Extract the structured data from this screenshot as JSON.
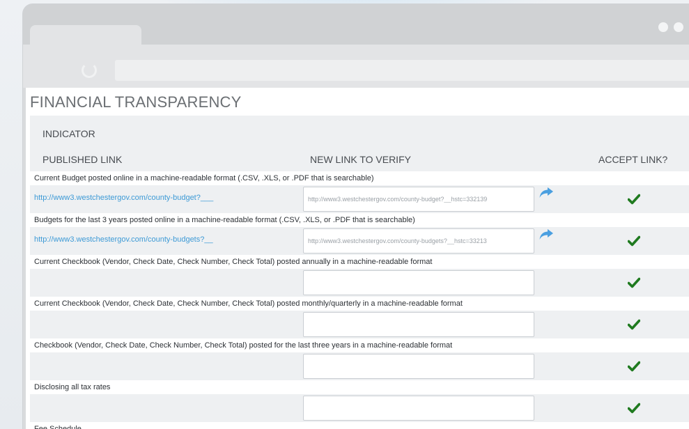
{
  "page": {
    "title": "FINANCIAL TRANSPARENCY",
    "indicator_label": "INDICATOR",
    "columns": {
      "published": "PUBLISHED LINK",
      "new": "NEW LINK TO VERIFY",
      "accept": "ACCEPT LINK?"
    }
  },
  "indicators": [
    {
      "description": "Current Budget posted online in a machine-readable format (.CSV, .XLS, or .PDF that is searchable)",
      "published_link": "http://www3.westchestergov.com/county-budget?___",
      "verify_value": "http://www3.westchestergov.com/county-budget?__hstc=332139",
      "has_share": true
    },
    {
      "description": "Budgets for the last 3 years posted online in a machine-readable format (.CSV, .XLS, or .PDF that is searchable)",
      "published_link": "http://www3.westchestergov.com/county-budgets?__",
      "verify_value": "http://www3.westchestergov.com/county-budgets?__hstc=33213",
      "has_share": true
    },
    {
      "description": "Current Checkbook (Vendor, Check Date, Check Number, Check Total) posted annually in a machine-readable format",
      "published_link": "",
      "verify_value": "",
      "has_share": false
    },
    {
      "description": "Current Checkbook (Vendor, Check Date, Check Number, Check Total) posted monthly/quarterly in a machine-readable format",
      "published_link": "",
      "verify_value": "",
      "has_share": false
    },
    {
      "description": "Checkbook (Vendor, Check Date, Check Number, Check Total) posted for the last three years in a machine-readable format",
      "published_link": "",
      "verify_value": "",
      "has_share": false
    },
    {
      "description": "Disclosing all tax rates",
      "published_link": "",
      "verify_value": "",
      "has_share": false
    },
    {
      "description": "Fee Schedule",
      "published_link": "",
      "verify_value": "",
      "has_share": false
    }
  ],
  "icons": {
    "share": "share-icon",
    "accept": "checkmark-icon",
    "reload": "reload-icon"
  },
  "colors": {
    "link": "#3d9ad6",
    "check": "#1f7a1f",
    "share": "#4a9fe0"
  }
}
